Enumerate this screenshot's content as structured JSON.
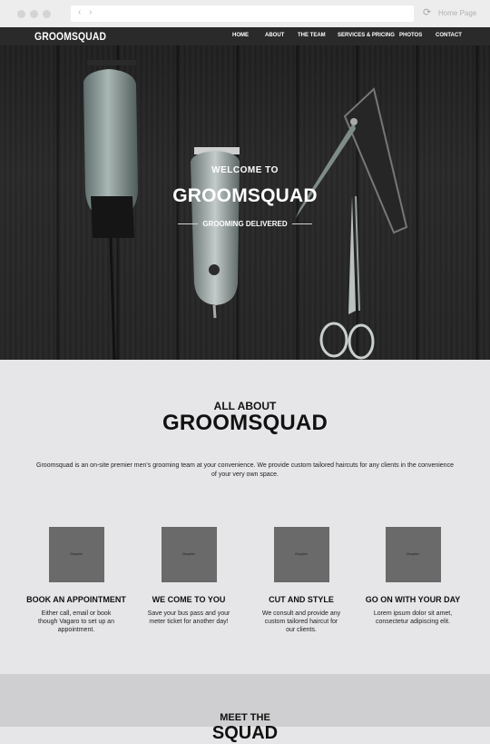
{
  "browser": {
    "nav_arrows": "‹ ›",
    "reload_icon": "⟳",
    "home_label": "Home Page"
  },
  "nav": {
    "brand": "GROOMSQUAD",
    "items": [
      "HOME",
      "ABOUT",
      "THE TEAM",
      "SERVICES & PRICING",
      "PHOTOS",
      "CONTACT"
    ]
  },
  "hero": {
    "welcome": "WELCOME TO",
    "title": "GROOMSQUAD",
    "tagline": "GROOMING DELIVERED"
  },
  "about": {
    "kicker": "ALL ABOUT",
    "title": "GROOMSQUAD",
    "description": "Groomsquad is an on-site premier men's grooming team at your convenience.  We provide custom tailored haircuts for any clients in the convenience of your very own space."
  },
  "features": [
    {
      "graphic": "Graphic",
      "title": "BOOK AN APPOINTMENT",
      "text": "Either call, email or book though Vagaro to set up an appointment."
    },
    {
      "graphic": "Graphic",
      "title": "WE COME TO YOU",
      "text": "Save your bus pass and your meter ticket for another day!"
    },
    {
      "graphic": "Graphic",
      "title": "CUT AND STYLE",
      "text": "We consult and provide any custom tailored haircut for our clients."
    },
    {
      "graphic": "Graphic",
      "title": "GO ON WITH YOUR DAY",
      "text": "Lorem ipsum dolor sit amet, consectetur adipiscing elit."
    }
  ],
  "team": {
    "kicker": "MEET THE",
    "title": "SQUAD"
  }
}
